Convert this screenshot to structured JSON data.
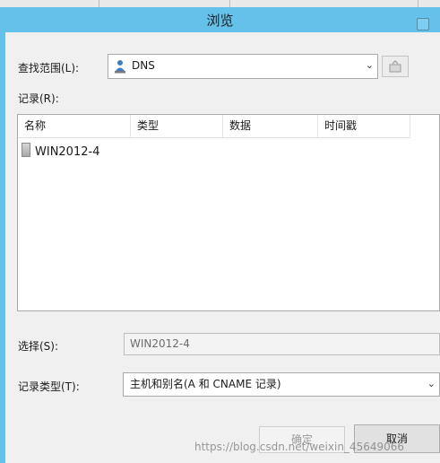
{
  "window": {
    "title": "浏览"
  },
  "look_in": {
    "label": "查找范围(L):",
    "value": "DNS",
    "icon": "dns-user-icon",
    "dropdown_icon": "chevron-down-icon",
    "up_button_icon": "folder-up-icon"
  },
  "records": {
    "label": "记录(R):",
    "columns": [
      "名称",
      "类型",
      "数据",
      "时间戳"
    ],
    "rows": [
      {
        "name": "WIN2012-4",
        "icon": "server-icon"
      }
    ]
  },
  "selection": {
    "label": "选择(S):",
    "value": "WIN2012-4"
  },
  "record_type": {
    "label": "记录类型(T):",
    "value": "主机和别名(A 和 CNAME 记录)"
  },
  "buttons": {
    "ok": "确定",
    "cancel": "取消"
  },
  "watermark": "https://blog.csdn.net/weixin_45649066"
}
